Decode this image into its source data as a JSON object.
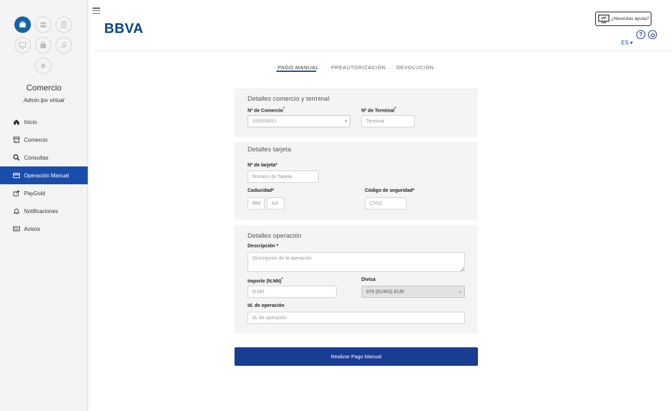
{
  "sidebar": {
    "merchant_name": "Comercio",
    "user_role": "Admin.tpv virtual",
    "nav_items": [
      {
        "label": "Inicio",
        "icon": "home-icon"
      },
      {
        "label": "Comercio",
        "icon": "store-icon"
      },
      {
        "label": "Consultas",
        "icon": "search-icon"
      },
      {
        "label": "Operación Manual",
        "icon": "credit-card-icon",
        "active": true
      },
      {
        "label": "PayGold",
        "icon": "share-icon"
      },
      {
        "label": "Notificaciones",
        "icon": "bell-icon"
      },
      {
        "label": "Avisos",
        "icon": "keyboard-icon"
      }
    ]
  },
  "header": {
    "logo_text": "BBVA",
    "help_label": "¿Necesitas ayuda?",
    "help_icon_label": "?",
    "language": "ES ▾"
  },
  "tabs": [
    {
      "label": "PAGO MANUAL",
      "active": true
    },
    {
      "label": "PREAUTORIZACIÓN",
      "active": false
    },
    {
      "label": "DEVOLUCIÓN",
      "active": false
    }
  ],
  "merchant_section": {
    "title": "Detalles comercio y terminal",
    "merchant_number_label": "Nº de Comercio",
    "merchant_number_value": "999008881",
    "terminal_label": "Nº de Terminal",
    "terminal_placeholder": "Terminal"
  },
  "card_section": {
    "title": "Detalles tarjeta",
    "card_number_label": "Nº de tarjeta*",
    "card_number_placeholder": "Número de Tarjeta",
    "expiry_label": "Caducidad*",
    "month_placeholder": "MM",
    "year_placeholder": "AA",
    "cvv_label": "Código de seguridad*",
    "cvv_placeholder": "CVV2"
  },
  "operation_section": {
    "title": "Detalles operación",
    "description_label": "Descripción *",
    "description_placeholder": "Descripción de la operación",
    "amount_label": "Importe (N.NN)",
    "amount_placeholder": "N.NN",
    "currency_label": "Divisa",
    "currency_value": "978 (EURO) EUR",
    "operation_id_label": "Id. de operación",
    "operation_id_placeholder": "Id. de operación"
  },
  "submit_label": "Realizar Pago Manual",
  "colors": {
    "primary": "#1a4dab",
    "brand": "#004481",
    "button": "#1a3d94",
    "sidebar_bg": "#f4f4f4",
    "panel_bg": "#f4f4f4"
  }
}
